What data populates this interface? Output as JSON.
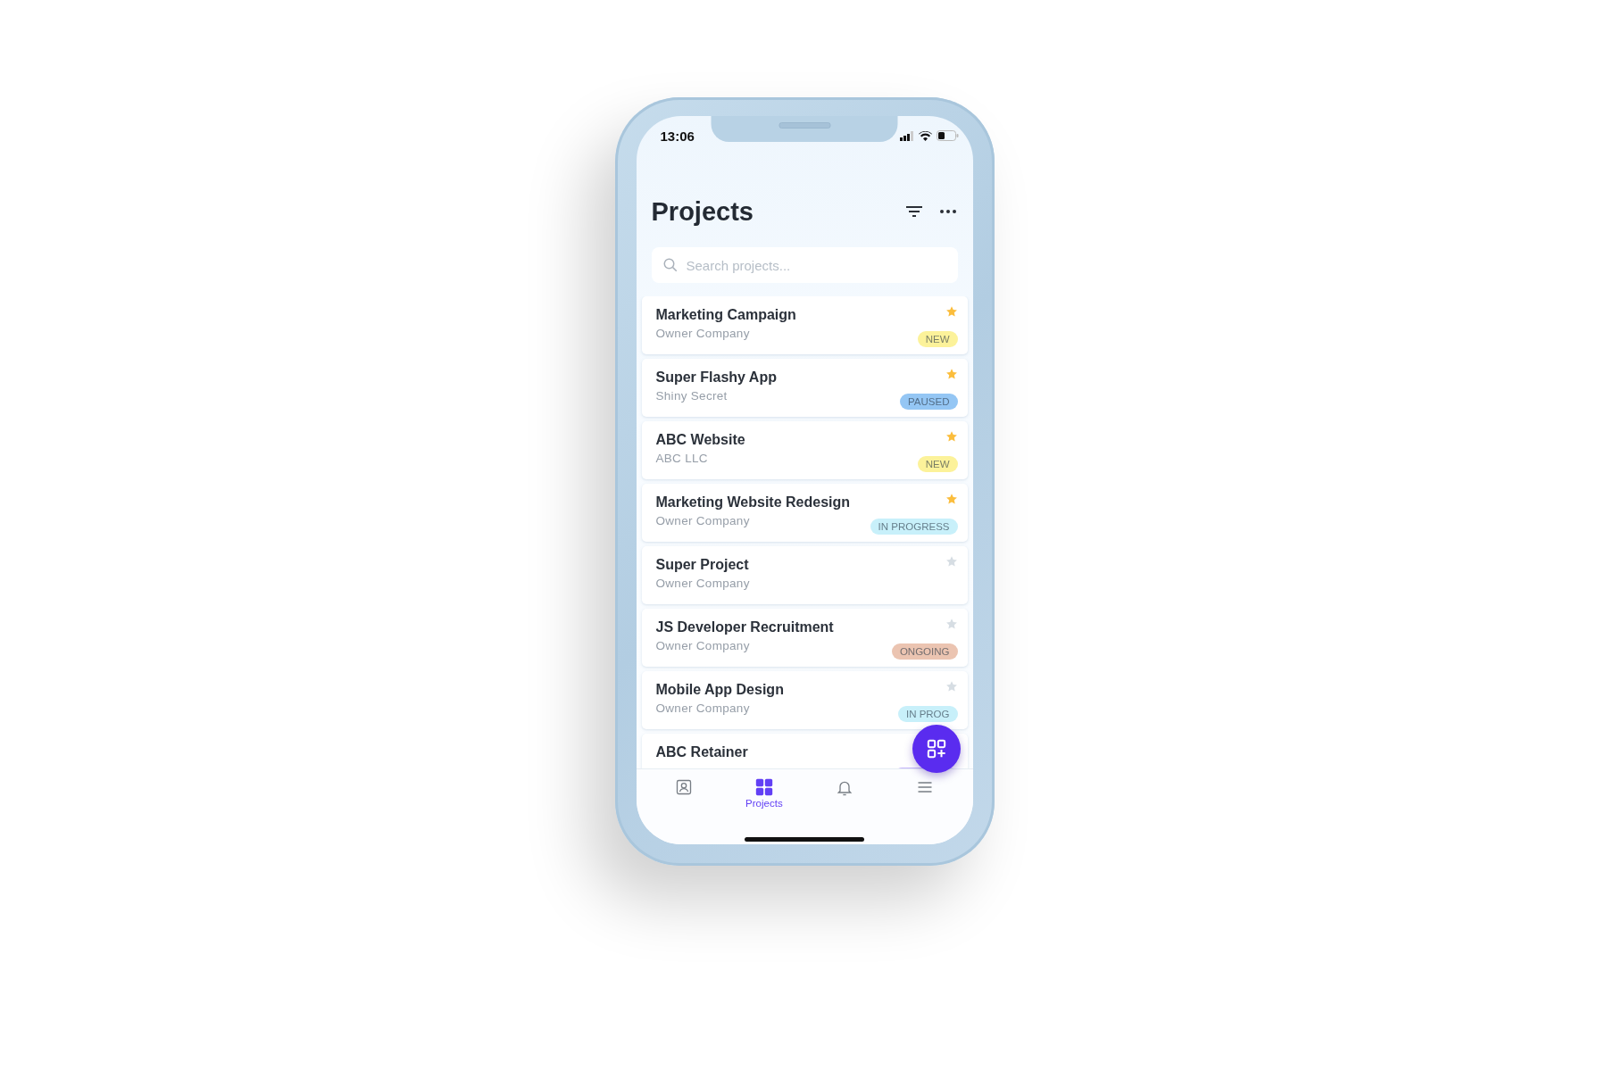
{
  "status_bar": {
    "time": "13:06"
  },
  "header": {
    "title": "Projects"
  },
  "search": {
    "placeholder": "Search projects..."
  },
  "projects": [
    {
      "name": "Marketing Campaign",
      "company": "Owner Company",
      "starred": true,
      "status": {
        "label": "NEW",
        "color": "#fcf29a"
      }
    },
    {
      "name": "Super Flashy App",
      "company": "Shiny Secret",
      "starred": true,
      "status": {
        "label": "PAUSED",
        "color": "#94c6f4"
      }
    },
    {
      "name": "ABC Website",
      "company": "ABC LLC",
      "starred": true,
      "status": {
        "label": "NEW",
        "color": "#fcf29a"
      }
    },
    {
      "name": "Marketing Website Redesign",
      "company": "Owner Company",
      "starred": true,
      "status": {
        "label": "IN PROGRESS",
        "color": "#c8f0fa"
      }
    },
    {
      "name": "Super Project",
      "company": "Owner Company",
      "starred": false
    },
    {
      "name": "JS Developer Recruitment",
      "company": "Owner Company",
      "starred": false,
      "status": {
        "label": "ONGOING",
        "color": "#ebc4b1"
      }
    },
    {
      "name": "Mobile App Design",
      "company": "Owner Company",
      "starred": false,
      "status": {
        "label": "IN PROG",
        "color": "#c8f0fa"
      }
    },
    {
      "name": "ABC Retainer",
      "status": {
        "color": "#c4b4fa"
      }
    }
  ],
  "nav": [
    {
      "kind": "contact",
      "selected": false
    },
    {
      "kind": "grid",
      "selected": true,
      "label": "Projects"
    },
    {
      "kind": "bell",
      "selected": false
    },
    {
      "kind": "menu",
      "selected": false
    }
  ]
}
